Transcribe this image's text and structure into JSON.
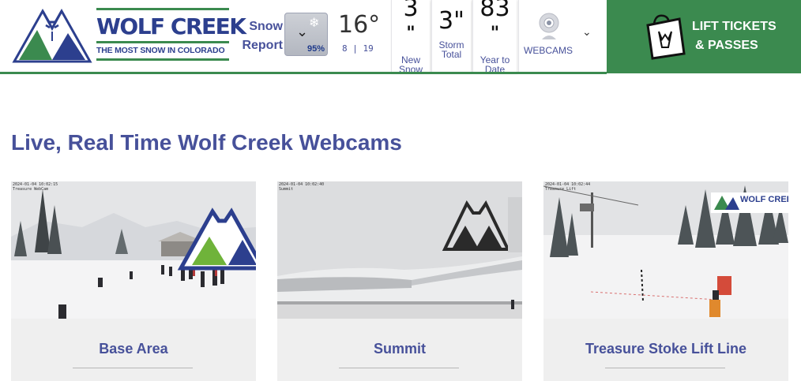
{
  "brand": {
    "name": "WOLF CREEK",
    "tagline": "THE MOST SNOW IN COLORADO"
  },
  "header": {
    "snow_report": {
      "line1": "Snow",
      "line2": "Report"
    },
    "weather": {
      "chance": "95%",
      "icon": "snow-cloud-icon"
    },
    "temperature": {
      "current": "16°",
      "low": "8",
      "separator": "|",
      "high": "19"
    },
    "stats": [
      {
        "value": "3",
        "unit": "\"",
        "label1": "New",
        "label2": "Snow"
      },
      {
        "value": "3\"",
        "unit": "",
        "label1": "Storm",
        "label2": "Total"
      },
      {
        "value": "83",
        "unit": "\"",
        "label1": "Year to",
        "label2": "Date"
      }
    ],
    "webcams": {
      "label": "WEBCAMS",
      "icon": "webcam-icon",
      "caret": "chevron-down-icon"
    },
    "lift_tickets": {
      "line1": "LIFT TICKETS",
      "line2": "& PASSES",
      "icon": "ticket-bag-icon"
    }
  },
  "main": {
    "title": "Live, Real Time Wolf Creek Webcams",
    "cams": [
      {
        "name": "Base Area",
        "stamp": "2024-01-04 10:02:15",
        "stamp2": "Treasure WebCam"
      },
      {
        "name": "Summit",
        "stamp": "2024-01-04 10:02:40",
        "stamp2": "Summit"
      },
      {
        "name": "Treasure Stoke Lift Line",
        "stamp": "2024-01-04 10:02:44",
        "stamp2": "Treasure Lift"
      }
    ]
  },
  "colors": {
    "brand_blue": "#2c3f8e",
    "title_blue": "#47519a",
    "brand_green": "#3b8a4f"
  }
}
